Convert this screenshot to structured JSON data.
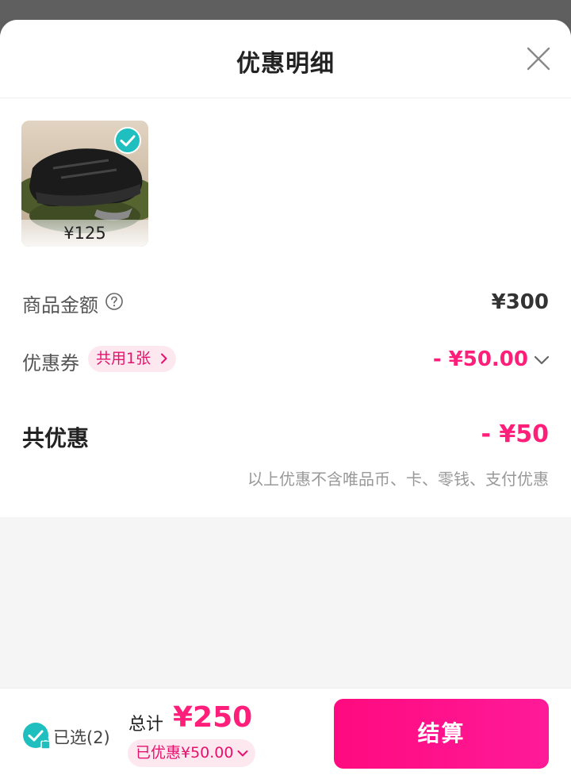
{
  "header": {
    "title": "优惠明细"
  },
  "product": {
    "price": "¥125",
    "selected": true
  },
  "rows": {
    "goods_amount_label": "商品金额",
    "goods_amount_value": "¥300",
    "coupon_label": "优惠券",
    "coupon_badge": "共用1张",
    "coupon_value": "- ¥50.00"
  },
  "summary": {
    "total_discount_label": "共优惠",
    "total_discount_value": "- ¥50",
    "note": "以上优惠不含唯品币、卡、零钱、支付优惠"
  },
  "footer": {
    "selected_text": "已选(2)",
    "total_label": "总计",
    "total_value": "¥250",
    "saved_text": "已优惠¥50.00",
    "checkout_label": "结算"
  },
  "colors": {
    "accent": "#ff1f7a",
    "check": "#1fbfbf"
  }
}
